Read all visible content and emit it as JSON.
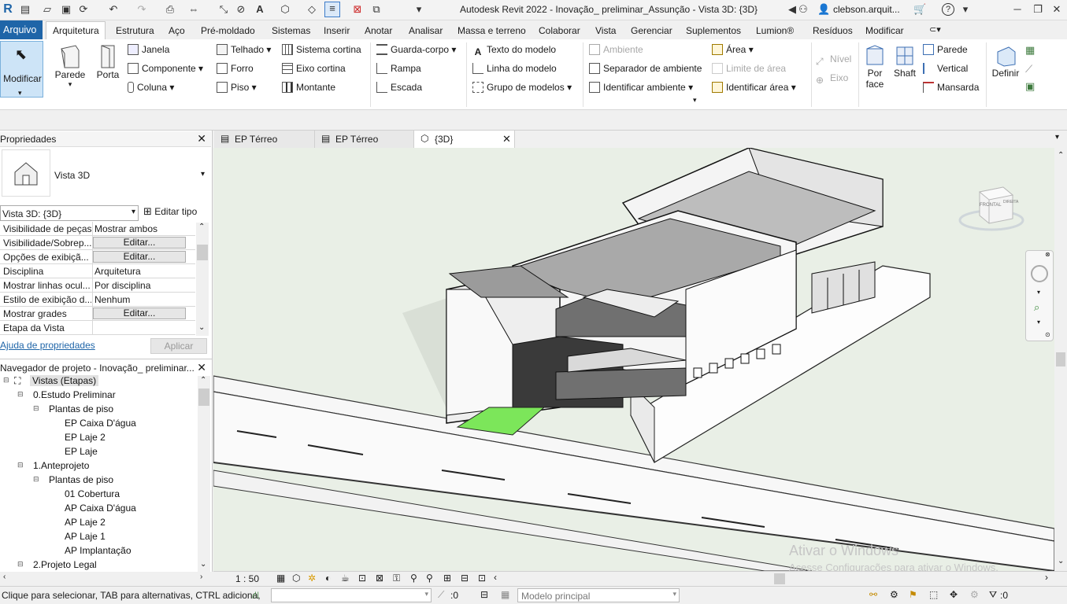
{
  "title": "Autodesk Revit 2022 - Inovação_ preliminar_Assunção - Vista 3D: {3D}",
  "user": "clebson.arquit...",
  "menus": [
    "Arquivo",
    "Arquitetura",
    "Estrutura",
    "Aço",
    "Pré-moldado",
    "Sistemas",
    "Inserir",
    "Anotar",
    "Analisar",
    "Massa e terreno",
    "Colaborar",
    "Vista",
    "Gerenciar",
    "Suplementos",
    "Lumion®",
    "Resíduos",
    "Modificar"
  ],
  "ribbon": {
    "modificar": "Modificar",
    "parede": "Parede",
    "porta": "Porta",
    "janela": "Janela",
    "componente": "Componente",
    "coluna": "Coluna",
    "telhado": "Telhado",
    "forro": "Forro",
    "piso": "Piso",
    "sistema_cortina": "Sistema cortina",
    "eixo_cortina": "Eixo cortina",
    "montante": "Montante",
    "guarda_corpo": "Guarda-corpo",
    "rampa": "Rampa",
    "escada": "Escada",
    "texto_modelo": "Texto do modelo",
    "linha_modelo": "Linha do modelo",
    "grupo_modelos": "Grupo de modelos",
    "ambiente": "Ambiente",
    "separador_ambiente": "Separador de ambiente",
    "identificar_ambiente": "Identificar ambiente",
    "area": "Área",
    "limite_area": "Limite de área",
    "identificar_area": "Identificar área",
    "nivel": "Nível",
    "eixo": "Eixo",
    "por_face_1": "Por",
    "por_face_2": "face",
    "shaft": "Shaft",
    "parede2": "Parede",
    "vertical": "Vertical",
    "mansarda": "Mansarda",
    "definir": "Definir"
  },
  "properties": {
    "title": "Propriedades",
    "type_name": "Vista 3D",
    "selector": "Vista 3D: {3D}",
    "edit_type": "Editar tipo",
    "rows": [
      {
        "name": "Visibilidade de peças",
        "value": "Mostrar ambos",
        "button": false
      },
      {
        "name": "Visibilidade/Sobrep...",
        "value": "Editar...",
        "button": true
      },
      {
        "name": "Opções de exibiçã...",
        "value": "Editar...",
        "button": true
      },
      {
        "name": "Disciplina",
        "value": "Arquitetura",
        "button": false
      },
      {
        "name": "Mostrar linhas ocul...",
        "value": "Por disciplina",
        "button": false
      },
      {
        "name": "Estilo de exibição d...",
        "value": "Nenhum",
        "button": false
      },
      {
        "name": "Mostrar grades",
        "value": "Editar...",
        "button": true
      },
      {
        "name": "Etapa da Vista",
        "value": "",
        "button": false
      }
    ],
    "help": "Ajuda de propriedades",
    "apply": "Aplicar"
  },
  "browser": {
    "title": "Navegador de projeto - Inovação_ preliminar...",
    "items": [
      {
        "label": "Vistas (Etapas)",
        "level": 0
      },
      {
        "label": "0.Estudo Preliminar",
        "level": 1
      },
      {
        "label": "Plantas de piso",
        "level": 2
      },
      {
        "label": "EP Caixa D'água",
        "level": 3
      },
      {
        "label": "EP Laje 2",
        "level": 3
      },
      {
        "label": "EP Laje",
        "level": 3
      },
      {
        "label": "1.Anteprojeto",
        "level": 1
      },
      {
        "label": "Plantas de piso",
        "level": 2
      },
      {
        "label": "01 Cobertura",
        "level": 3
      },
      {
        "label": "AP Caixa D'água",
        "level": 3
      },
      {
        "label": "AP Laje 2",
        "level": 3
      },
      {
        "label": "AP Laje 1",
        "level": 3
      },
      {
        "label": "AP Implantação",
        "level": 3
      },
      {
        "label": "2.Projeto Legal",
        "level": 1
      }
    ]
  },
  "tabs": [
    "EP Térreo",
    "EP Térreo",
    "{3D}"
  ],
  "viewcube": {
    "front": "FRONTAL",
    "right": "DIREITA"
  },
  "viewbar": {
    "scale": "1 : 50"
  },
  "watermark": {
    "line1": "Ativar o Windows",
    "line2": "Acesse Configurações para ativar o Windows."
  },
  "status": {
    "hint": "Clique para selecionar, TAB para alternativas, CTRL adiciona,",
    "zero1": ":0",
    "model": "Modelo principal",
    "zero2": ":0"
  }
}
